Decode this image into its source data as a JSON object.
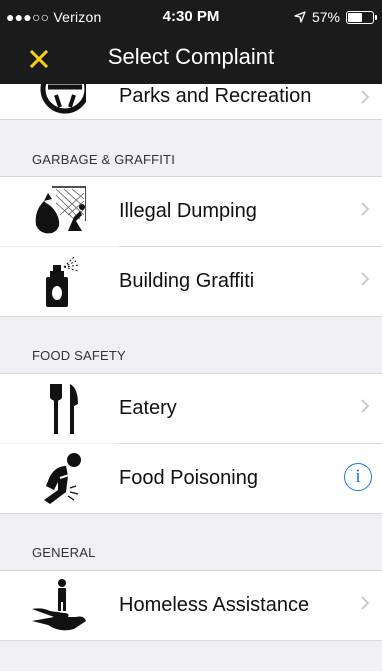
{
  "status_bar": {
    "carrier": "●●●○○ Verizon",
    "time": "4:30 PM",
    "battery_percent": "57%",
    "battery_level": 0.57
  },
  "nav": {
    "title": "Select Complaint",
    "close_icon": "close-icon",
    "accent": "#f5d40f"
  },
  "sections": [
    {
      "header": "",
      "items": [
        {
          "label": "Parks and Recreation",
          "icon": "park-bench-icon",
          "accessory": "chevron"
        }
      ]
    },
    {
      "header": "GARBAGE & GRAFFITI",
      "items": [
        {
          "label": "Illegal Dumping",
          "icon": "dumping-icon",
          "accessory": "chevron"
        },
        {
          "label": "Building Graffiti",
          "icon": "spray-can-icon",
          "accessory": "chevron"
        }
      ]
    },
    {
      "header": "FOOD SAFETY",
      "items": [
        {
          "label": "Eatery",
          "icon": "fork-knife-icon",
          "accessory": "chevron"
        },
        {
          "label": "Food Poisoning",
          "icon": "sick-person-icon",
          "accessory": "info"
        }
      ]
    },
    {
      "header": "GENERAL",
      "items": [
        {
          "label": "Homeless Assistance",
          "icon": "helping-hand-icon",
          "accessory": "chevron"
        }
      ]
    }
  ]
}
